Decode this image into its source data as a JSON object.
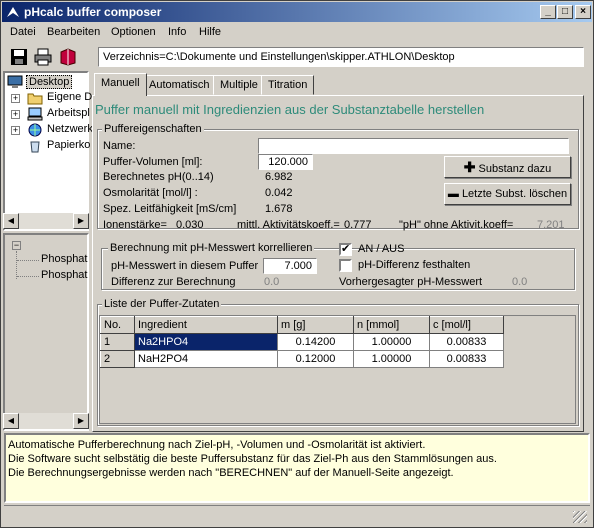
{
  "window": {
    "title": "pHcalc buffer composer"
  },
  "menu": [
    "Datei",
    "Bearbeiten",
    "Optionen",
    "Info",
    "Hilfe"
  ],
  "toolbar": {
    "icons": [
      "save-icon",
      "print-icon",
      "book-icon"
    ]
  },
  "path": "Verzeichnis=C:\\Dokumente und Einstellungen\\skipper.ATHLON\\Desktop",
  "tree_top": {
    "root": "Desktop",
    "items": [
      "Eigene D",
      "Arbeitspl",
      "Netzwerk",
      "Papierko"
    ]
  },
  "tree_bottom": {
    "items": [
      "Phosphat",
      "Phosphat"
    ]
  },
  "tabs": [
    "Manuell",
    "Automatisch",
    "Multiple",
    "Titration"
  ],
  "heading": "Puffer manuell mit Ingredienzien aus der Substanztabelle herstellen",
  "props": {
    "group_title": "Puffereigenschaften",
    "name_label": "Name:",
    "name_value": "",
    "volume_label": "Puffer-Volumen [ml]:",
    "volume_value": "120.000",
    "ph_label": "Berechnetes pH(0..14)",
    "ph_value": "6.982",
    "osm_label": "Osmolarität [mol/l] :",
    "osm_value": "0.042",
    "cond_label": "Spez. Leitfähigkeit [mS/cm]",
    "cond_value": "1.678",
    "ionic_label": "Ionenstärke=",
    "ionic_value": "0.030",
    "activity_label": "mittl. Aktivitätskoeff.=",
    "activity_value": "0.777",
    "ph_noact_label": "\"pH\" ohne Aktivit.koeff=",
    "ph_noact_value": "7.201",
    "add_button": "Substanz dazu",
    "delete_button": "Letzte Subst. löschen"
  },
  "measure": {
    "group_title": "Berechnung mit pH-Messwert korrellieren",
    "on_off_label": "AN / AUS",
    "on_off_checked": true,
    "measured_label": "pH-Messwert in diesem Puffer",
    "measured_value": "7.000",
    "fix_label": "pH-Differenz festhalten",
    "fix_checked": false,
    "diff_label": "Differenz zur Berechnung",
    "diff_value": "0.0",
    "predicted_label": "Vorhergesagter pH-Messwert",
    "predicted_value": "0.0"
  },
  "ingredients": {
    "group_title": "Liste der Puffer-Zutaten",
    "headers": [
      "No.",
      "Ingredient",
      "m [g]",
      "n [mmol]",
      "c [mol/l]"
    ],
    "rows": [
      [
        "1",
        "Na2HPO4",
        "0.14200",
        "1.00000",
        "0.00833"
      ],
      [
        "2",
        "NaH2PO4",
        "0.12000",
        "1.00000",
        "0.00833"
      ]
    ]
  },
  "status_text": [
    "Automatische Pufferberechnung nach Ziel-pH, -Volumen und -Osmolarität ist aktiviert.",
    "Die Software sucht selbstätig die beste Puffersubstanz für das Ziel-Ph aus den Stammlösungen aus.",
    "Die Berechnungsergebnisse werden nach \"BERECHNEN\" auf der Manuell-Seite angezeigt."
  ],
  "colors": {
    "heading": "#2e8b7a",
    "selection": "#0a246a",
    "status_bg": "#ffffdd"
  }
}
